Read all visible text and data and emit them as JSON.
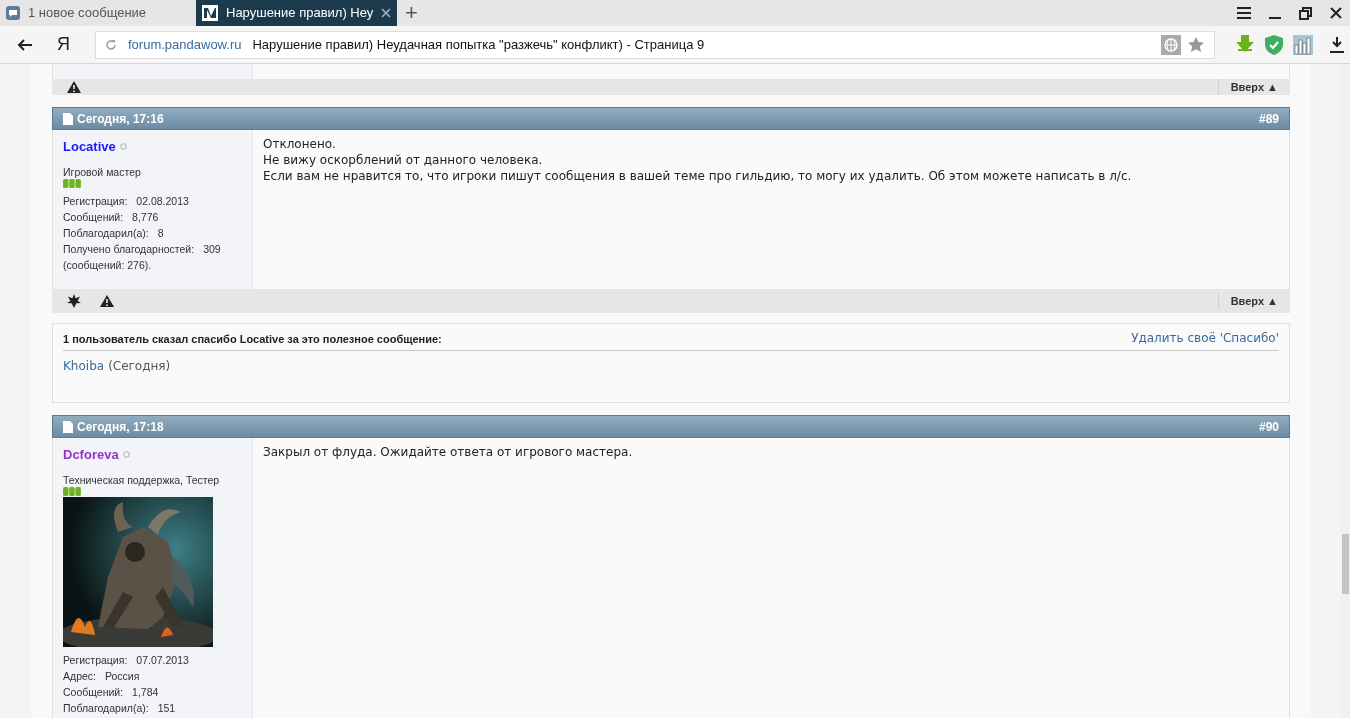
{
  "browser": {
    "tabs": [
      {
        "title": "1 новое сообщение",
        "selected": false,
        "kind": "chat"
      },
      {
        "title": "Нарушение правил) Неу",
        "selected": true,
        "kind": "logo"
      }
    ],
    "new_tab": "+",
    "address": {
      "logo": "Я",
      "domain": "forum.pandawow.ru",
      "title": "Нарушение правил) Неудачная попытка \"разжечь\" конфликт) - Страница 9"
    }
  },
  "page": {
    "top_footer": {
      "icons": [
        {
          "kind": "warning"
        }
      ],
      "up_label": "Вверх ▲"
    },
    "posts": [
      {
        "date": "Сегодня, 17:16",
        "number": "#89",
        "author": {
          "name": "Locative",
          "color": "#1a1aff"
        },
        "rank": "Игровой мастер",
        "stats": [
          {
            "label": "Регистрация:",
            "value": "02.08.2013"
          },
          {
            "label": "Сообщений:",
            "value": "8,776"
          },
          {
            "label": "Поблагодарил(а):",
            "value": "8"
          },
          {
            "label": "Получено благодарностей:",
            "value": "309"
          },
          {
            "label": "(сообщений: 276)."
          }
        ],
        "lines": [
          "Отклонено.",
          "Не вижу оскорблений от данного человека.",
          "Если вам не нравится то, что игроки пишут сообщения в вашей теме про гильдию, то могу их удалить. Об этом можете написать в л/с."
        ],
        "footer": {
          "icons": [
            {
              "kind": "star"
            },
            {
              "kind": "warning"
            }
          ],
          "up_label": "Вверх ▲"
        },
        "thanks": {
          "summary": "1 пользователь сказал спасибо Locative за это полезное сообщение:",
          "remove_link": "Удалить своё 'Спасибо'",
          "users": [
            {
              "name": "Khoiba",
              "when": "(Сегодня)"
            }
          ]
        }
      },
      {
        "date": "Сегодня, 17:18",
        "number": "#90",
        "author": {
          "name": "Dcforeva",
          "color": "#9933cc"
        },
        "rank": "Техническая поддержка, Тестер",
        "avatar": {
          "kind": "picture"
        },
        "stats": [
          {
            "label": "Регистрация:",
            "value": "07.07.2013"
          },
          {
            "label": "Адрес:",
            "value": "Россия"
          },
          {
            "label": "Сообщений:",
            "value": "1,784"
          },
          {
            "label": "Поблагодарил(а):",
            "value": "151"
          }
        ],
        "lines": [
          "Закрыл от флуда. Ожидайте ответа от игрового мастера."
        ]
      }
    ]
  }
}
